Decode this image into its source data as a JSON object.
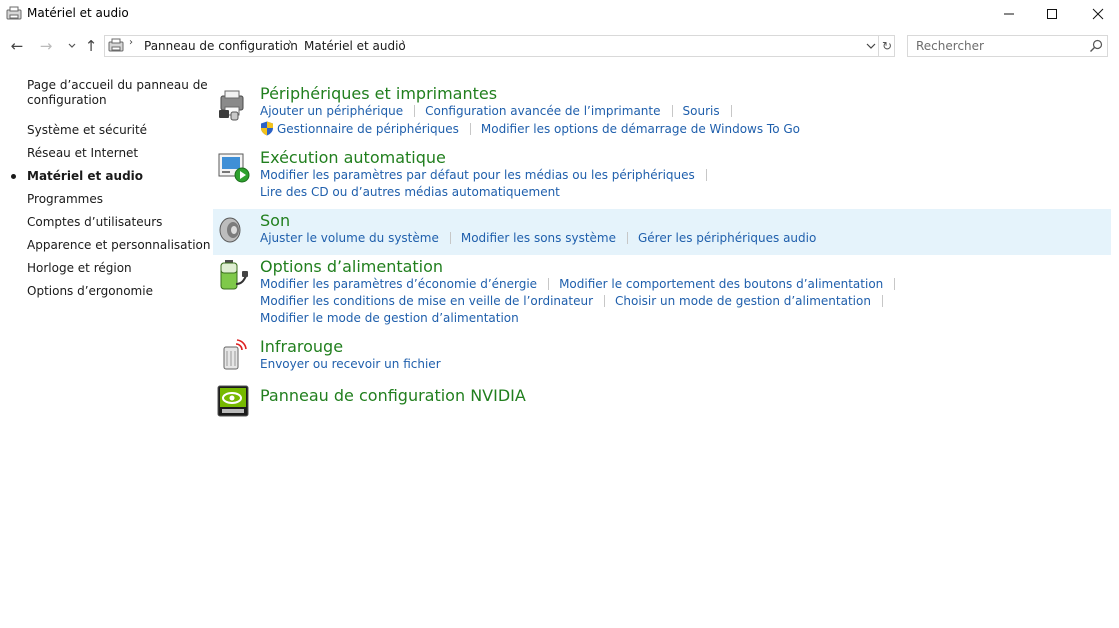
{
  "window": {
    "title": "Matériel et audio",
    "controls": {
      "minimize": "—",
      "maximize": "☐",
      "close": "✕"
    }
  },
  "nav": {
    "back_icon": "←",
    "forward_icon": "→",
    "recent_icon": "⌄",
    "up_icon": "↑"
  },
  "address": {
    "crumbs": [
      "Panneau de configuration",
      "Matériel et audio"
    ],
    "separator": "›",
    "refresh_icon": "↻"
  },
  "search": {
    "placeholder": "Rechercher"
  },
  "sidebar": {
    "items": [
      {
        "label": "Page d’accueil du panneau de"
      },
      {
        "label": "configuration"
      },
      {
        "label": "Système et sécurité"
      },
      {
        "label": "Réseau et Internet"
      },
      {
        "label": "Matériel et audio",
        "current": true
      },
      {
        "label": "Programmes"
      },
      {
        "label": "Comptes d’utilisateurs"
      },
      {
        "label": "Apparence et personnalisation"
      },
      {
        "label": "Horloge et région"
      },
      {
        "label": "Options d’ergonomie"
      }
    ]
  },
  "categories": [
    {
      "title": "Périphériques et imprimantes",
      "icon": "printer-devices-icon",
      "lines": [
        [
          "Ajouter un périphérique",
          "Configuration avancée de l’imprimante",
          "Souris"
        ],
        [
          "Gestionnaire de périphériques",
          "Modifier les options de démarrage de Windows To Go"
        ]
      ]
    },
    {
      "title": "Exécution automatique",
      "icon": "autoplay-icon",
      "lines": [
        [
          "Modifier les paramètres par défaut pour les médias ou les périphériques"
        ],
        [
          "Lire des CD ou d’autres médias automatiquement"
        ]
      ]
    },
    {
      "title": "Son",
      "icon": "speaker-icon",
      "lines": [
        [
          "Ajuster le volume du système",
          "Modifier les sons système",
          "Gérer les périphériques audio"
        ]
      ]
    },
    {
      "title": "Options d’alimentation",
      "icon": "battery-power-icon",
      "lines": [
        [
          "Modifier les paramètres d’économie d’énergie",
          "Modifier le comportement des boutons d’alimentation"
        ],
        [
          "Modifier les conditions de mise en veille de l’ordinateur",
          "Choisir un mode de gestion d’alimentation"
        ],
        [
          "Modifier le mode de gestion d’alimentation"
        ]
      ]
    },
    {
      "title": "Infrarouge",
      "icon": "infrared-icon",
      "lines": [
        [
          "Envoyer ou recevoir un fichier"
        ]
      ]
    },
    {
      "title": "Panneau de configuration NVIDIA",
      "icon": "nvidia-icon",
      "lines": []
    }
  ],
  "colors": {
    "category_title": "#217f1e",
    "link": "#1f5fac",
    "hover_row": "#e5f3fb"
  }
}
